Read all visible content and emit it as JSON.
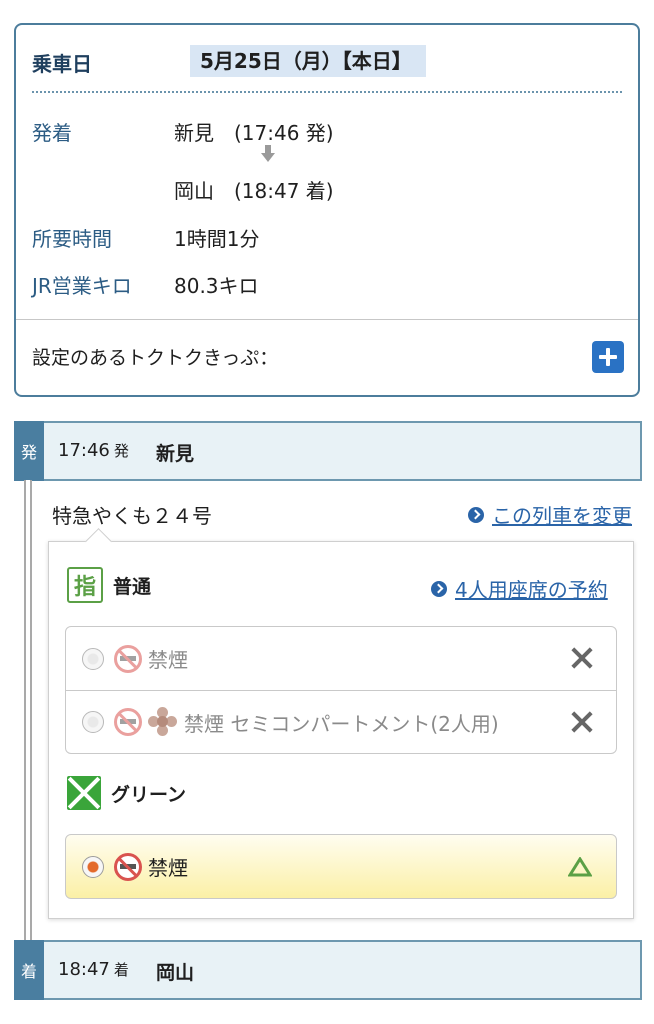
{
  "summary": {
    "date_label": "乗車日",
    "date_value": "5月25日（月）【本日】",
    "depart_arrive_label": "発着",
    "from_line": "新見　(17:46 発)",
    "to_line": "岡山　(18:47 着)",
    "duration_label": "所要時間",
    "duration_value": "1時間1分",
    "distance_label": "JR営業キロ",
    "distance_value": "80.3キロ",
    "discount_label": "設定のあるトクトクきっぷ："
  },
  "departure": {
    "badge": "発",
    "time": "17:46",
    "suffix": "発",
    "station": "新見"
  },
  "train": {
    "name": "特急やくも２４号",
    "change_link": "この列車を変更"
  },
  "reserved": {
    "icon_text": "指",
    "class_name": "普通",
    "four_seat_link": "4人用座席の予約",
    "options": [
      {
        "label": "禁煙"
      },
      {
        "label": "禁煙 セミコンパートメント(2人用)"
      }
    ]
  },
  "green": {
    "class_name": "グリーン",
    "options": [
      {
        "label": "禁煙"
      }
    ]
  },
  "arrival": {
    "badge": "着",
    "time": "18:47",
    "suffix": "着",
    "station": "岡山"
  },
  "colors": {
    "accent": "#2a64a8",
    "border": "#4c7d9c",
    "station_bg": "#e8f2f6",
    "green_class": "#3aa53a",
    "reserved_class": "#5ba046",
    "availability_limited": "#5ba046"
  },
  "icons": [
    "arrow-down-icon",
    "plus-icon",
    "chevron-circle-icon",
    "no-smoking-icon",
    "semi-compartment-icon",
    "unavailable-x-icon",
    "limited-triangle-icon",
    "green-car-icon",
    "reserved-seat-icon"
  ]
}
